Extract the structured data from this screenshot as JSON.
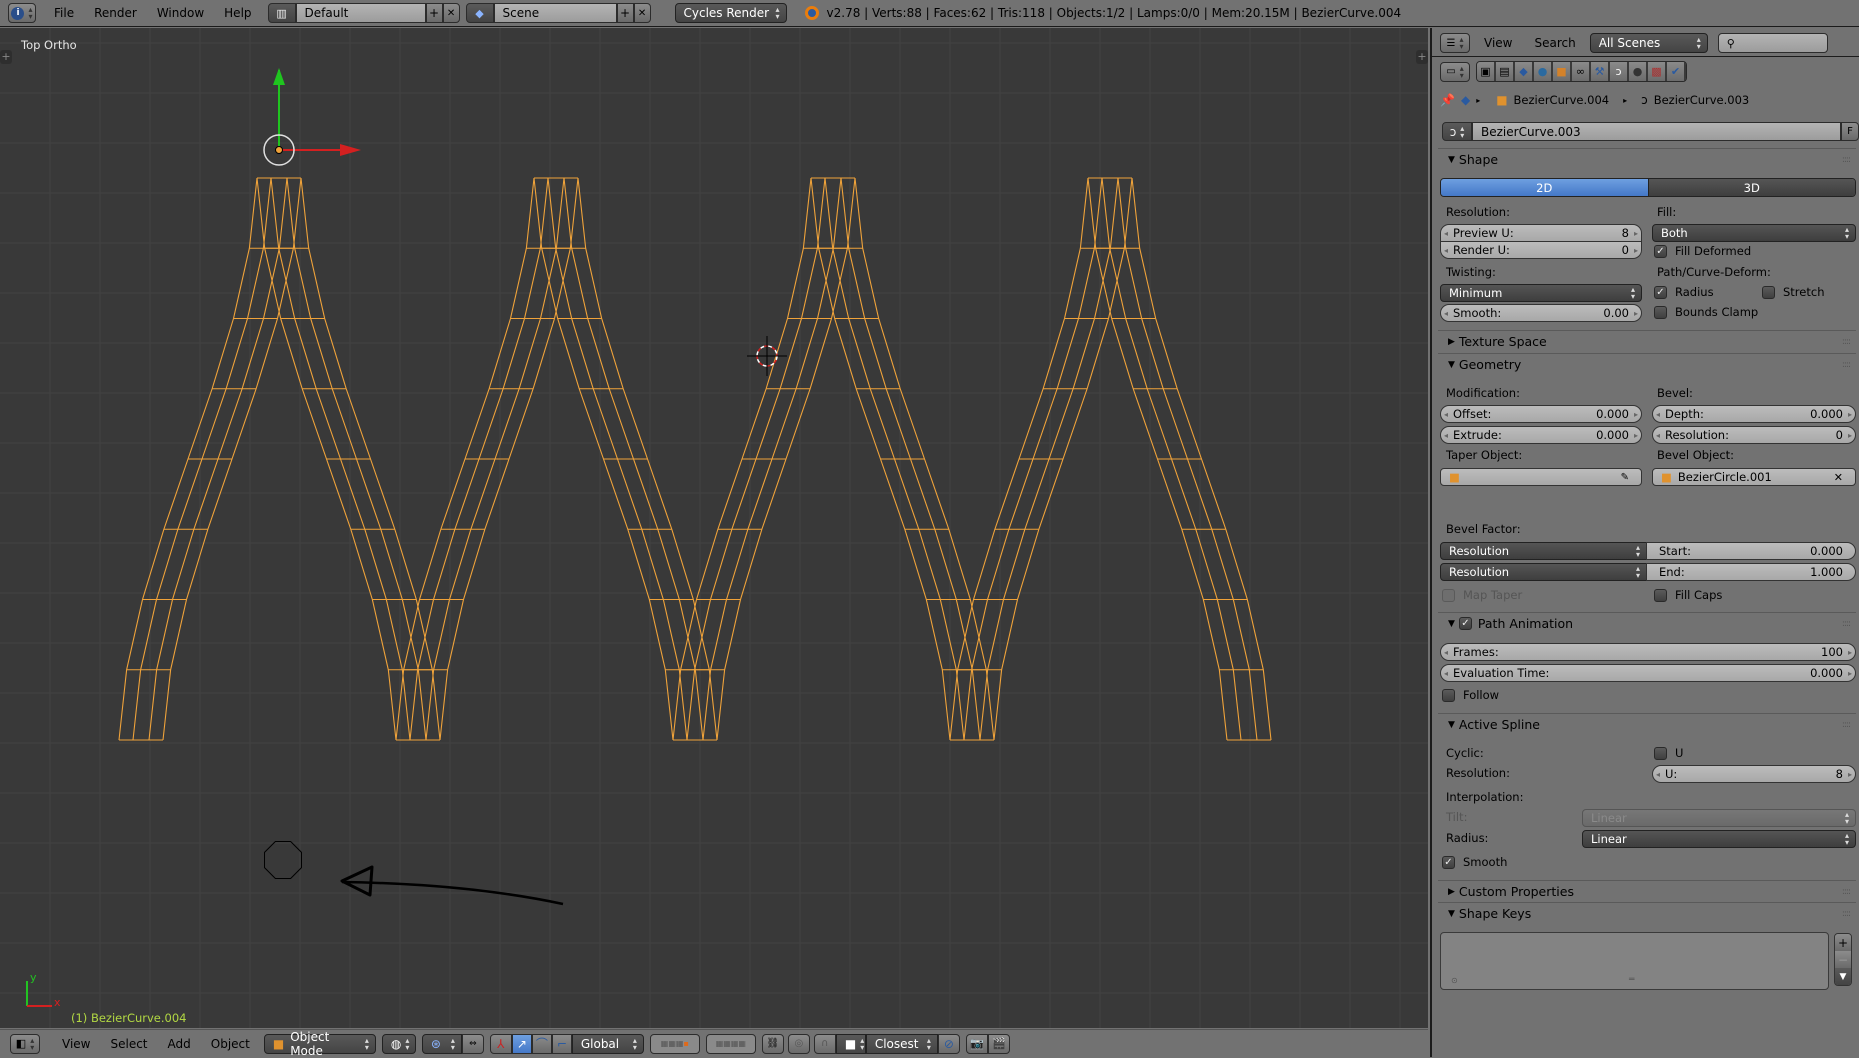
{
  "topbar": {
    "menus": [
      "File",
      "Render",
      "Window",
      "Help"
    ],
    "layout": "Default",
    "scene": "Scene",
    "engine": "Cycles Render",
    "stats": "v2.78 | Verts:88 | Faces:62 | Tris:118 | Objects:1/2 | Lamps:0/0 | Mem:20.15M | BezierCurve.004"
  },
  "viewport": {
    "view_label": "Top Ortho",
    "object_label": "(1) BezierCurve.004",
    "axis_x": "x",
    "axis_y": "y",
    "wire_color": "#f0a33a",
    "background": "#393939"
  },
  "bottombar": {
    "menus": [
      "View",
      "Select",
      "Add",
      "Object"
    ],
    "mode": "Object Mode",
    "orientation": "Global",
    "snap_target": "Closest"
  },
  "outliner": {
    "menus": [
      "View",
      "Search"
    ],
    "scope": "All Scenes",
    "search_placeholder": ""
  },
  "properties": {
    "breadcrumb": [
      "BezierCurve.004",
      "BezierCurve.003"
    ],
    "datablock": "BezierCurve.003",
    "fake_user": "F",
    "shape": {
      "title": "Shape",
      "dim_2d": "2D",
      "dim_3d": "3D",
      "resolution_label": "Resolution:",
      "preview_u_label": "Preview U:",
      "preview_u": "8",
      "render_u_label": "Render U:",
      "render_u": "0",
      "fill_label": "Fill:",
      "fill": "Both",
      "fill_deformed": "Fill Deformed",
      "twisting_label": "Twisting:",
      "twisting": "Minimum",
      "smooth_label": "Smooth:",
      "smooth": "0.00",
      "path_deform_label": "Path/Curve-Deform:",
      "radius": "Radius",
      "stretch": "Stretch",
      "bounds_clamp": "Bounds Clamp"
    },
    "texture_space": {
      "title": "Texture Space"
    },
    "geometry": {
      "title": "Geometry",
      "modification_label": "Modification:",
      "offset_label": "Offset:",
      "offset": "0.000",
      "extrude_label": "Extrude:",
      "extrude": "0.000",
      "bevel_label": "Bevel:",
      "depth_label": "Depth:",
      "depth": "0.000",
      "resolution_label": "Resolution:",
      "resolution": "0",
      "taper_object_label": "Taper Object:",
      "taper_object": "",
      "bevel_object_label": "Bevel Object:",
      "bevel_object": "BezierCircle.001",
      "bevel_factor_label": "Bevel Factor:",
      "factor_mapping_start": "Resolution",
      "factor_mapping_end": "Resolution",
      "start_label": "Start:",
      "start": "0.000",
      "end_label": "End:",
      "end": "1.000",
      "map_taper": "Map Taper",
      "fill_caps": "Fill Caps"
    },
    "path_animation": {
      "title": "Path Animation",
      "frames_label": "Frames:",
      "frames": "100",
      "eval_time_label": "Evaluation Time:",
      "eval_time": "0.000",
      "follow": "Follow"
    },
    "active_spline": {
      "title": "Active Spline",
      "cyclic_label": "Cyclic:",
      "cyclic_u": "U",
      "resolution_label": "Resolution:",
      "u_label": "U:",
      "u": "8",
      "interpolation_label": "Interpolation:",
      "tilt_label": "Tilt:",
      "tilt": "Linear",
      "radius_label": "Radius:",
      "radius": "Linear",
      "smooth": "Smooth"
    },
    "custom_properties": {
      "title": "Custom Properties"
    },
    "shape_keys": {
      "title": "Shape Keys"
    }
  }
}
